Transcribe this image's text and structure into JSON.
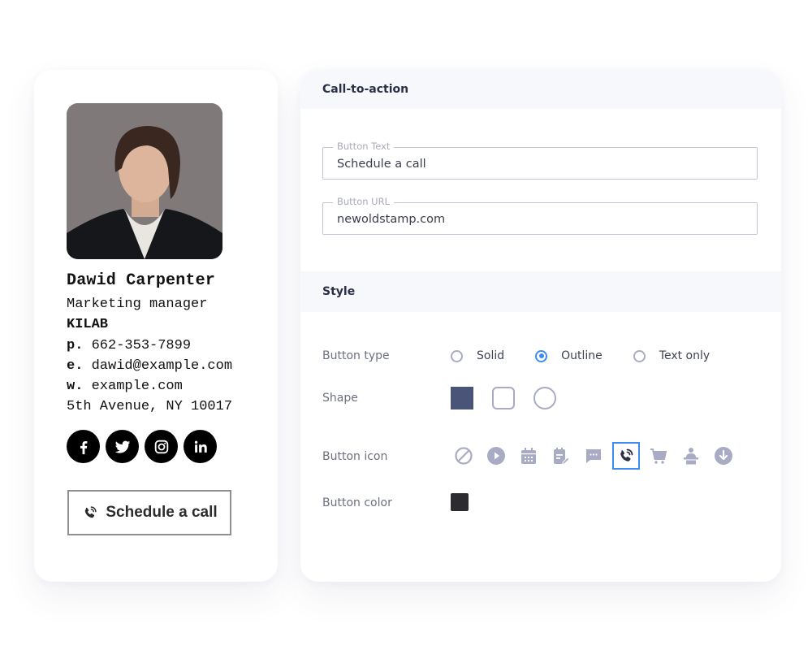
{
  "signature": {
    "name": "Dawid Carpenter",
    "title": "Marketing manager",
    "company": "KILAB",
    "phone_prefix": "p.",
    "phone": "662-353-7899",
    "email_prefix": "e.",
    "email": "dawid@example.com",
    "web_prefix": "w.",
    "website": "example.com",
    "address": "5th Avenue, NY 10017",
    "socials": [
      {
        "icon": "facebook-icon"
      },
      {
        "icon": "twitter-icon"
      },
      {
        "icon": "instagram-icon"
      },
      {
        "icon": "linkedin-icon"
      }
    ],
    "cta_button": {
      "label": "Schedule a call",
      "icon": "phone-call-icon"
    }
  },
  "panel": {
    "cta_section": {
      "title": "Call-to-action",
      "button_text": {
        "label": "Button Text",
        "value": "Schedule a call"
      },
      "button_url": {
        "label": "Button URL",
        "value": "newoldstamp.com"
      }
    },
    "style_section": {
      "title": "Style",
      "button_type": {
        "label": "Button type",
        "options": [
          "Solid",
          "Outline",
          "Text only"
        ],
        "selected": "Outline"
      },
      "shape": {
        "label": "Shape",
        "options": [
          "square",
          "rounded",
          "circle"
        ],
        "selected": "square"
      },
      "button_icon": {
        "label": "Button icon",
        "options": [
          "none-icon",
          "play-icon",
          "calendar-icon",
          "edit-note-icon",
          "chat-icon",
          "phone-call-icon",
          "cart-icon",
          "presenter-icon",
          "download-icon"
        ],
        "selected": "phone-call-icon"
      },
      "button_color": {
        "label": "Button color",
        "value": "#2c2c30"
      }
    }
  },
  "colors": {
    "accent": "#3d8bf5",
    "shape_fill": "#4a5478",
    "icon_muted": "#a9abc4"
  }
}
